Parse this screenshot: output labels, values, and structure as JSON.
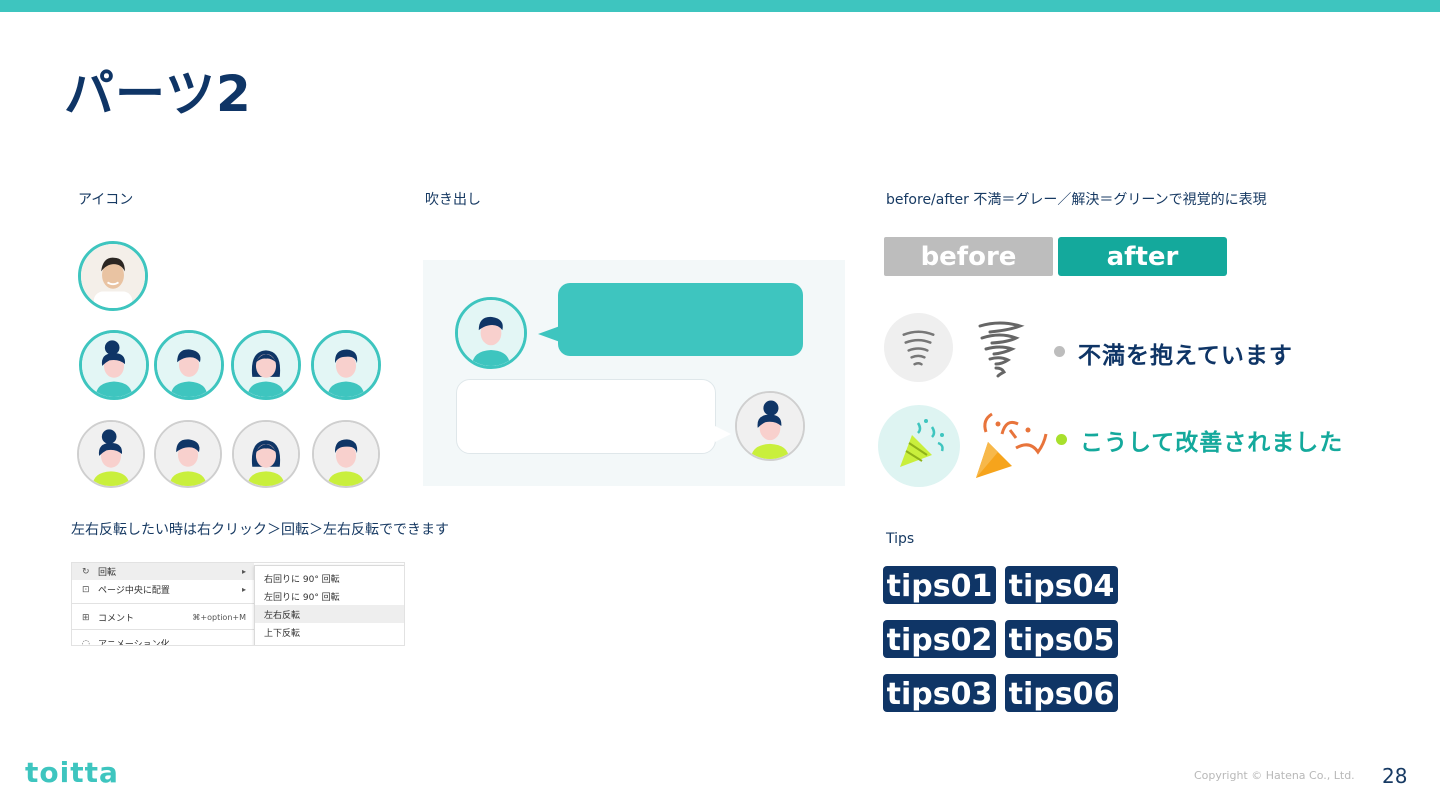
{
  "slide": {
    "title": "パーツ2",
    "page_number": "28",
    "copyright": "Copyright © Hatena Co., Ltd.",
    "logo": "toitta"
  },
  "sections": {
    "icons_label": "アイコン",
    "bubbles_label": "吹き出し",
    "before_after_label": "before/after  不満＝グレー／解決＝グリーンで視覚的に表現",
    "flip_label": "左右反転したい時は右クリック＞回転＞左右反転でできます",
    "tips_label": "Tips"
  },
  "before_after": {
    "before": "before",
    "after": "after",
    "complaint_text": "不満を抱えています",
    "solved_text": "こうして改善されました"
  },
  "context_menu": {
    "rows": [
      {
        "icon": "rotate-icon",
        "label": "回転",
        "right": "▸"
      },
      {
        "icon": "align-icon",
        "label": "ページ中央に配置",
        "right": "▸"
      },
      {
        "icon": "comment-icon",
        "label": "コメント",
        "right": "⌘+option+M"
      },
      {
        "icon": "animation-icon",
        "label": "アニメーション化",
        "right": ""
      }
    ],
    "submenu": [
      "右回りに 90° 回転",
      "左回りに 90° 回転",
      "左右反転",
      "上下反転"
    ]
  },
  "tips": [
    "tips01",
    "tips02",
    "tips03",
    "tips04",
    "tips05",
    "tips06"
  ],
  "colors": {
    "accent_teal": "#3ec5bf",
    "after_green": "#14a99c",
    "before_gray": "#bdbdbd",
    "navy": "#0f3566",
    "lime": "#c9ef3c"
  }
}
